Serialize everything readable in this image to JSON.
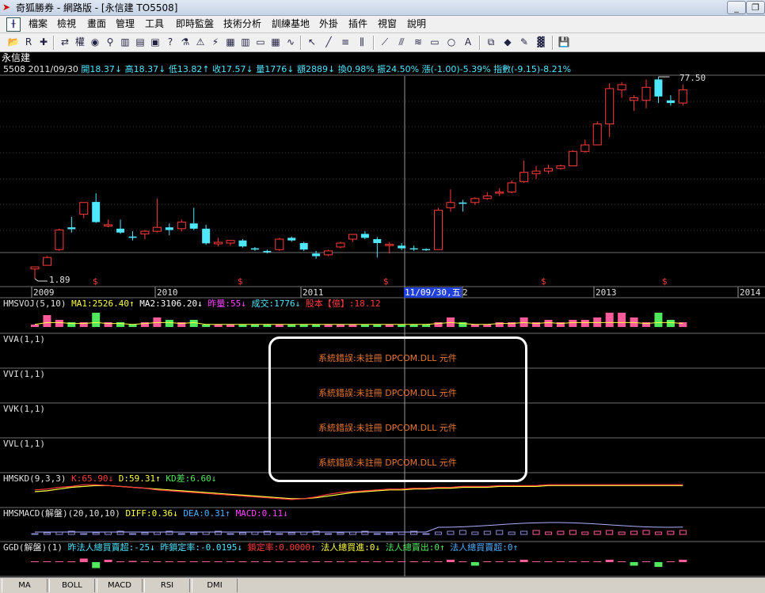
{
  "window": {
    "title": "奇狐勝券 - 網路版 - [永信建 TO5508]"
  },
  "menus": [
    "檔案",
    "檢視",
    "畫面",
    "管理",
    "工具",
    "即時監盤",
    "技術分析",
    "訓練基地",
    "外掛",
    "插件",
    "視窗",
    "說明"
  ],
  "toolbar": {
    "icons": [
      "folder-icon",
      "rsi-icon",
      "move-icon",
      "swap-icon",
      "rights-icon",
      "binoculars-icon",
      "zoom-icon",
      "bar-chart-icon",
      "book-icon",
      "book-open-icon",
      "help-icon",
      "flask-icon",
      "alarm-icon",
      "warning-icon",
      "grid-icon",
      "layout-icon",
      "window-icon",
      "table-icon",
      "trend-icon",
      "cursor-icon",
      "line-draw-icon",
      "text-list-icon",
      "parallel-icon",
      "fan-icon",
      "channel-icon",
      "fibonacci-icon",
      "rect-icon",
      "circle-icon",
      "text-a-icon",
      "copy-icon",
      "eraser-icon",
      "brush-icon",
      "color-grid-icon",
      "save-icon"
    ]
  },
  "stock": {
    "name": "永信建",
    "code": "5508",
    "date": "2011/09/30",
    "open": "開18.37↓",
    "high": "高18.37↓",
    "low": "低13.82↑",
    "close": "收17.57↓",
    "volume": "量1776↓",
    "amount": "額2889↓",
    "turnover": "換0.98%",
    "amplitude": "振24.50%",
    "change": "漲(-1.00)-5.39%",
    "index": "指數(-9.15)-8.21%"
  },
  "price": {
    "high_label": "77.50",
    "low_label": "1.89"
  },
  "years": [
    "2009",
    "2010",
    "2011",
    "2012",
    "2013",
    "2014"
  ],
  "cursor_date": "11/09/30,五",
  "dividend_mark": "$",
  "panels": {
    "vol": {
      "name": "HMSVOJ(5,10)",
      "ma1": "MA1:2526.40↑",
      "ma2": "MA2:3106.20↓",
      "yesterday": "昨量:55↓",
      "deal": "成交:1776↓",
      "capital": "股本【億】:18.12"
    },
    "vva": "VVA(1,1)",
    "vvi": "VVI(1,1)",
    "vvk": "VVK(1,1)",
    "vvl": "VVL(1,1)",
    "kd": {
      "name": "HMSKD(9,3,3)",
      "k": "K:65.90↓",
      "d": "D:59.31↑",
      "diff": "KD差:6.60↓"
    },
    "macd": {
      "name": "HMSMACD(解盤)(20,10,10)",
      "diff": "DIFF:0.36↓",
      "dea": "DEA:0.31↑",
      "macd": "MACD:0.11↓"
    },
    "ggd": {
      "name": "GGD(解盤)(1)",
      "a": "昨法人總買賣超:-25↓",
      "b": "昨鎖定率:-0.0195↓",
      "c": "鎖定率:0.0000↑",
      "d": "法人總買進:0↓",
      "e": "法人總賣出:0↑",
      "f": "法人總買賣超:0↑"
    }
  },
  "error_message": "系統錯誤:未註冊 DPCOM.DLL 元件",
  "bottom_tabs": [
    "MA",
    "BOLL",
    "MACD",
    "RSI",
    "DMI"
  ],
  "colors": {
    "up": "#ff3a3a",
    "down": "#4fe7ff",
    "vol_up": "#ff5a9a",
    "vol_down": "#52e85e",
    "grid": "#3a3a3a",
    "error": "#e87830"
  },
  "chart_data": {
    "type": "candlestick",
    "title": "永信建 5508",
    "x": [
      "2009",
      "2010",
      "2011",
      "2012",
      "2013",
      "2014"
    ],
    "price_range": [
      1.89,
      77.5
    ],
    "candles": [
      {
        "o": 5.6,
        "h": 6.5,
        "l": 1.9,
        "c": 6.4
      },
      {
        "o": 7.0,
        "h": 10.5,
        "l": 7.0,
        "c": 10.0
      },
      {
        "o": 13.0,
        "h": 21.0,
        "l": 12.5,
        "c": 20.5
      },
      {
        "o": 21.5,
        "h": 25.5,
        "l": 19.5,
        "c": 20.8
      },
      {
        "o": 26.5,
        "h": 31.0,
        "l": 25.0,
        "c": 31.0
      },
      {
        "o": 31.2,
        "h": 34.5,
        "l": 23.2,
        "c": 23.5
      },
      {
        "o": 22.0,
        "h": 24.5,
        "l": 21.5,
        "c": 22.5
      },
      {
        "o": 21.0,
        "h": 24.5,
        "l": 19.0,
        "c": 19.5
      },
      {
        "o": 18.0,
        "h": 20.0,
        "l": 16.5,
        "c": 17.5
      },
      {
        "o": 19.0,
        "h": 20.5,
        "l": 17.0,
        "c": 20.0
      },
      {
        "o": 20.0,
        "h": 32.5,
        "l": 19.5,
        "c": 21.5
      },
      {
        "o": 21.5,
        "h": 23.0,
        "l": 18.5,
        "c": 20.5
      },
      {
        "o": 21.0,
        "h": 24.5,
        "l": 20.0,
        "c": 23.5
      },
      {
        "o": 23.0,
        "h": 29.0,
        "l": 20.5,
        "c": 21.0
      },
      {
        "o": 21.0,
        "h": 22.5,
        "l": 14.8,
        "c": 15.4
      },
      {
        "o": 15.2,
        "h": 17.5,
        "l": 14.2,
        "c": 15.8
      },
      {
        "o": 15.5,
        "h": 16.5,
        "l": 14.5,
        "c": 16.5
      },
      {
        "o": 16.5,
        "h": 17.0,
        "l": 13.8,
        "c": 14.2
      },
      {
        "o": 13.5,
        "h": 14.0,
        "l": 12.5,
        "c": 13.0
      },
      {
        "o": 12.5,
        "h": 13.0,
        "l": 11.5,
        "c": 12.0
      },
      {
        "o": 13.0,
        "h": 17.5,
        "l": 12.5,
        "c": 17.0
      },
      {
        "o": 17.5,
        "h": 18.0,
        "l": 16.0,
        "c": 16.5
      },
      {
        "o": 15.5,
        "h": 16.0,
        "l": 12.5,
        "c": 13.0
      },
      {
        "o": 11.5,
        "h": 12.5,
        "l": 9.5,
        "c": 10.5
      },
      {
        "o": 11.0,
        "h": 13.0,
        "l": 10.5,
        "c": 12.5
      },
      {
        "o": 14.0,
        "h": 16.0,
        "l": 13.5,
        "c": 15.5
      },
      {
        "o": 17.0,
        "h": 19.0,
        "l": 16.0,
        "c": 18.8
      },
      {
        "o": 19.0,
        "h": 20.0,
        "l": 17.0,
        "c": 17.5
      },
      {
        "o": 17.0,
        "h": 17.8,
        "l": 10.0,
        "c": 15.5
      },
      {
        "o": 15.0,
        "h": 15.8,
        "l": 11.5,
        "c": 15.0
      },
      {
        "o": 14.5,
        "h": 15.5,
        "l": 12.8,
        "c": 13.5
      },
      {
        "o": 13.5,
        "h": 14.5,
        "l": 12.5,
        "c": 13.2
      },
      {
        "o": 13.2,
        "h": 13.5,
        "l": 12.5,
        "c": 13.0
      },
      {
        "o": 13.0,
        "h": 29.0,
        "l": 13.0,
        "c": 28.0
      },
      {
        "o": 29.0,
        "h": 36.0,
        "l": 27.5,
        "c": 31.0
      },
      {
        "o": 31.0,
        "h": 32.0,
        "l": 27.5,
        "c": 30.5
      },
      {
        "o": 31.0,
        "h": 33.0,
        "l": 30.0,
        "c": 32.5
      },
      {
        "o": 32.5,
        "h": 35.0,
        "l": 32.0,
        "c": 33.5
      },
      {
        "o": 35.0,
        "h": 36.5,
        "l": 33.5,
        "c": 35.0
      },
      {
        "o": 35.0,
        "h": 39.5,
        "l": 34.5,
        "c": 38.5
      },
      {
        "o": 39.0,
        "h": 47.0,
        "l": 38.5,
        "c": 42.5
      },
      {
        "o": 42.0,
        "h": 45.0,
        "l": 40.0,
        "c": 43.0
      },
      {
        "o": 43.0,
        "h": 45.5,
        "l": 42.0,
        "c": 44.0
      },
      {
        "o": 44.0,
        "h": 45.5,
        "l": 43.5,
        "c": 45.0
      },
      {
        "o": 45.0,
        "h": 51.0,
        "l": 45.0,
        "c": 50.5
      },
      {
        "o": 50.5,
        "h": 55.0,
        "l": 50.0,
        "c": 53.0
      },
      {
        "o": 53.0,
        "h": 62.0,
        "l": 53.0,
        "c": 61.0
      },
      {
        "o": 61.0,
        "h": 76.5,
        "l": 56.0,
        "c": 74.5
      },
      {
        "o": 74.0,
        "h": 77.0,
        "l": 71.0,
        "c": 76.0
      },
      {
        "o": 70.0,
        "h": 72.0,
        "l": 66.0,
        "c": 71.0
      },
      {
        "o": 70.0,
        "h": 78.0,
        "l": 67.0,
        "c": 75.0
      },
      {
        "o": 78.0,
        "h": 79.0,
        "l": 69.0,
        "c": 71.5
      },
      {
        "o": 70.0,
        "h": 72.0,
        "l": 68.0,
        "c": 69.0
      },
      {
        "o": 69.0,
        "h": 76.0,
        "l": 68.0,
        "c": 74.0
      }
    ],
    "volume": [
      1,
      5,
      3,
      2,
      2,
      6,
      2,
      2,
      1,
      2,
      4,
      3,
      2,
      3,
      1,
      1,
      1,
      1,
      1,
      1,
      1,
      1,
      1,
      1,
      1,
      1,
      1,
      1,
      1,
      1,
      1,
      1,
      1,
      2,
      4,
      2,
      1,
      1,
      2,
      2,
      4,
      2,
      3,
      2,
      3,
      3,
      4,
      6,
      6,
      4,
      2,
      6,
      3,
      2
    ],
    "kd_k": [
      60,
      61,
      63,
      64,
      66,
      66,
      65,
      64,
      63,
      62,
      60,
      59,
      58,
      57,
      56,
      55,
      54,
      53,
      52,
      51,
      50,
      49,
      50,
      52,
      55,
      57,
      58,
      59,
      60,
      61,
      61,
      62,
      62,
      63,
      63,
      64,
      64,
      64,
      65,
      65,
      65,
      65,
      66,
      66,
      66,
      66,
      66,
      66,
      66,
      66,
      66,
      66,
      66,
      66
    ],
    "kd_d": [
      58,
      59,
      61,
      63,
      64,
      65,
      65,
      64,
      63,
      62,
      61,
      60,
      59,
      58,
      57,
      56,
      55,
      54,
      53,
      52,
      51,
      50,
      50,
      51,
      53,
      55,
      57,
      58,
      59,
      60,
      60,
      61,
      61,
      62,
      62,
      63,
      63,
      63,
      64,
      64,
      64,
      64,
      65,
      65,
      65,
      65,
      65,
      65,
      65,
      65,
      65,
      65,
      65,
      65
    ]
  }
}
